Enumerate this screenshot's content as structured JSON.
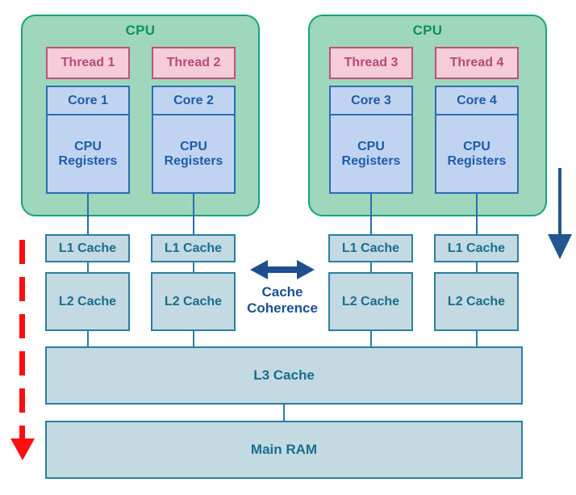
{
  "diagram": {
    "title": "CPU cache hierarchy with threads, cores and cache coherence",
    "colors": {
      "cpu_package_fill": "#9ed7bb",
      "cpu_package_border": "#17a37c",
      "cpu_package_text": "#0f8f63",
      "thread_fill": "#f5cdd9",
      "thread_border": "#c0507c",
      "thread_text": "#b8497a",
      "core_fill": "#c0d4f2",
      "core_border": "#2b6cb8",
      "core_text": "#1f5ba8",
      "cache_fill": "#c3dae2",
      "cache_border": "#2b7f9e",
      "cache_text": "#186e8c",
      "coherence_arrow": "#1d4f8f",
      "red_arrow": "#fb0f11",
      "blue_arrow": "#23568f"
    }
  },
  "packages": [
    {
      "label": "CPU",
      "cores": [
        {
          "thread": "Thread 1",
          "core": "Core 1",
          "registers": "CPU\nRegisters",
          "registers_line1": "CPU",
          "registers_line2": "Registers"
        },
        {
          "thread": "Thread 2",
          "core": "Core 2",
          "registers": "CPU\nRegisters",
          "registers_line1": "CPU",
          "registers_line2": "Registers"
        }
      ]
    },
    {
      "label": "CPU",
      "cores": [
        {
          "thread": "Thread 3",
          "core": "Core 3",
          "registers": "CPU\nRegisters",
          "registers_line1": "CPU",
          "registers_line2": "Registers"
        },
        {
          "thread": "Thread 4",
          "core": "Core 4",
          "registers": "CPU\nRegisters",
          "registers_line1": "CPU",
          "registers_line2": "Registers"
        }
      ]
    }
  ],
  "caches": {
    "l1_label": "L1 Cache",
    "l2_label": "L2 Cache",
    "l1": [
      "L1 Cache",
      "L1 Cache",
      "L1 Cache",
      "L1 Cache"
    ],
    "l2": [
      "L2 Cache",
      "L2 Cache",
      "L2 Cache",
      "L2 Cache"
    ],
    "l3": "L3 Cache",
    "ram": "Main RAM"
  },
  "coherence": {
    "line1": "Cache",
    "line2": "Coherence",
    "arrow": "double-headed-horizontal-arrow"
  },
  "annotations": {
    "latency_arrow": "red-dashed-down-arrow",
    "flow_arrow": "blue-down-arrow"
  }
}
